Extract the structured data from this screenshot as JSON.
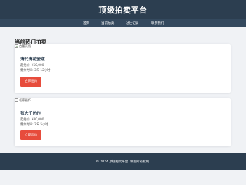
{
  "header": {
    "title": "顶级拍卖平台"
  },
  "nav": {
    "items": [
      {
        "label": "首页"
      },
      {
        "label": "当前拍卖"
      },
      {
        "label": "过往记录"
      },
      {
        "label": "联系我们"
      }
    ]
  },
  "main": {
    "section_title": "当前热门拍卖",
    "auctions": [
      {
        "image_alt": "古董花瓶",
        "name": "清代青花瓷瓶",
        "price_label": "起拍价: ¥50,000",
        "time_label": "剩余时间: 3天 12小时",
        "bid_label": "立即出价"
      },
      {
        "image_alt": "名家画作",
        "name": "张大千仿作",
        "price_label": "起拍价: ¥80,000",
        "time_label": "剩余时间: 2天 5小时",
        "bid_label": "立即出价"
      }
    ]
  },
  "footer": {
    "text": "© 2024 顶级拍卖平台. 保留所有权利."
  },
  "colors": {
    "header_bg": "#2c3e50",
    "nav_bg": "#34495e",
    "accent_button": "#e74c3c",
    "page_bg": "#f0f2f5"
  }
}
